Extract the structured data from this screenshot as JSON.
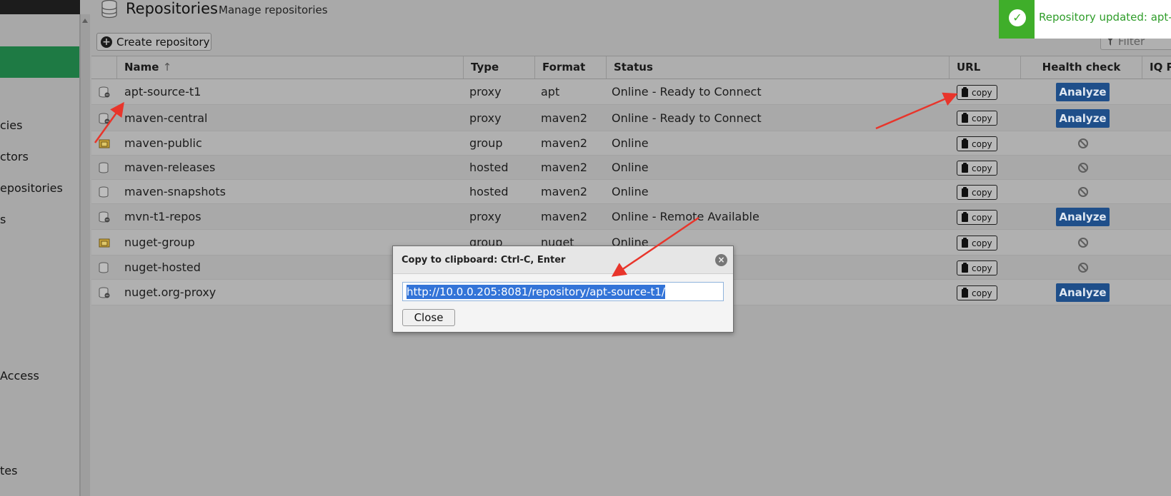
{
  "sidebar": {
    "items": [
      {
        "label": "cies"
      },
      {
        "label": "ctors"
      },
      {
        "label": "epositories"
      },
      {
        "label": "s"
      },
      {
        "label": "Access"
      },
      {
        "label": "tes"
      }
    ]
  },
  "header": {
    "icon": "database-icon",
    "title": "Repositories",
    "subtitle": "Manage repositories"
  },
  "toolbar": {
    "create_label": "Create repository",
    "filter_placeholder": "Filter"
  },
  "table": {
    "columns": [
      "Name",
      "Type",
      "Format",
      "Status",
      "URL",
      "Health check",
      "IQ P"
    ],
    "sort_indicator": "↑",
    "copy_label": "copy",
    "analyze_label": "Analyze",
    "rows": [
      {
        "name": "apt-source-t1",
        "type": "proxy",
        "format": "apt",
        "status": "Online - Ready to Connect",
        "health": "analyze",
        "icon": "proxy-repo-icon"
      },
      {
        "name": "maven-central",
        "type": "proxy",
        "format": "maven2",
        "status": "Online - Ready to Connect",
        "health": "analyze",
        "icon": "proxy-repo-icon"
      },
      {
        "name": "maven-public",
        "type": "group",
        "format": "maven2",
        "status": "Online",
        "health": "disabled",
        "icon": "group-repo-icon"
      },
      {
        "name": "maven-releases",
        "type": "hosted",
        "format": "maven2",
        "status": "Online",
        "health": "disabled",
        "icon": "hosted-repo-icon"
      },
      {
        "name": "maven-snapshots",
        "type": "hosted",
        "format": "maven2",
        "status": "Online",
        "health": "disabled",
        "icon": "hosted-repo-icon"
      },
      {
        "name": "mvn-t1-repos",
        "type": "proxy",
        "format": "maven2",
        "status": "Online - Remote Available",
        "health": "analyze",
        "icon": "proxy-repo-icon"
      },
      {
        "name": "nuget-group",
        "type": "group",
        "format": "nuget",
        "status": "Online",
        "health": "disabled",
        "icon": "group-repo-icon"
      },
      {
        "name": "nuget-hosted",
        "type": "",
        "format": "",
        "status": "",
        "health": "disabled",
        "icon": "hosted-repo-icon"
      },
      {
        "name": "nuget.org-proxy",
        "type": "",
        "format": "",
        "status": "ct",
        "health": "analyze",
        "icon": "proxy-repo-icon"
      }
    ]
  },
  "dialog": {
    "title": "Copy to clipboard: Ctrl-C, Enter",
    "url": "http://10.0.0.205:8081/repository/apt-source-t1/",
    "close_label": "Close"
  },
  "notification": {
    "text": "Repository updated: apt-sou",
    "color": "#3fae2a"
  },
  "colors": {
    "accent_green": "#1e7a44",
    "analyze_blue": "#1f4f8a",
    "annotation_red": "#e8352b"
  }
}
